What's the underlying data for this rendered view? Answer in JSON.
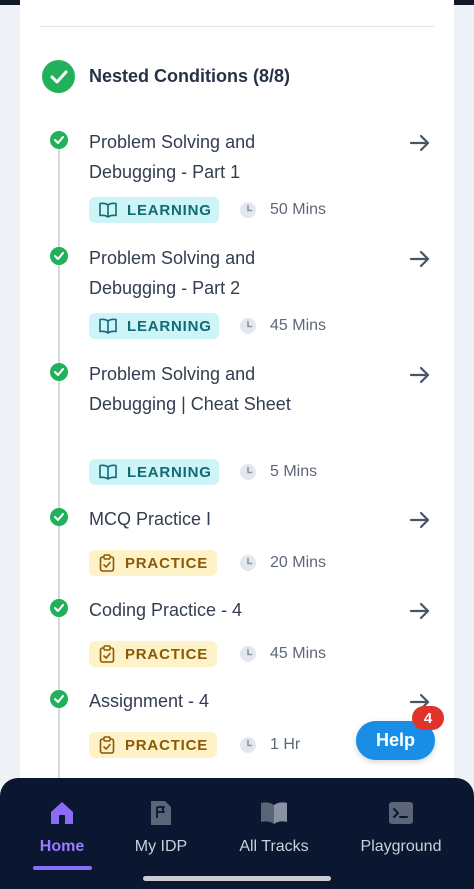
{
  "section": {
    "title": "Nested Conditions (8/8)"
  },
  "items": [
    {
      "title": "Problem Solving and Debugging - Part 1",
      "type": "LEARNING",
      "duration": "50 Mins"
    },
    {
      "title": "Problem Solving and Debugging - Part 2",
      "type": "LEARNING",
      "duration": "45 Mins"
    },
    {
      "title": "Problem Solving and Debugging | Cheat Sheet",
      "type": "LEARNING",
      "duration": "5 Mins"
    },
    {
      "title": "MCQ Practice I",
      "type": "PRACTICE",
      "duration": "20 Mins"
    },
    {
      "title": "Coding Practice - 4",
      "type": "PRACTICE",
      "duration": "45 Mins"
    },
    {
      "title": "Assignment - 4",
      "type": "PRACTICE",
      "duration": "1 Hr"
    }
  ],
  "help": {
    "label": "Help",
    "count": "4"
  },
  "nav": [
    {
      "label": "Home",
      "icon": "home-icon",
      "active": true
    },
    {
      "label": "My IDP",
      "icon": "flag-document-icon"
    },
    {
      "label": "All Tracks",
      "icon": "open-book-icon"
    },
    {
      "label": "Playground",
      "icon": "terminal-icon"
    }
  ],
  "colors": {
    "complete": "#22b15a",
    "learning_badge": "#cdf4f6",
    "practice_badge": "#fdf2c8",
    "help": "#1a8ee6",
    "notification": "#e0342a",
    "nav_background": "#0b1730",
    "nav_active": "#9b7bff"
  }
}
